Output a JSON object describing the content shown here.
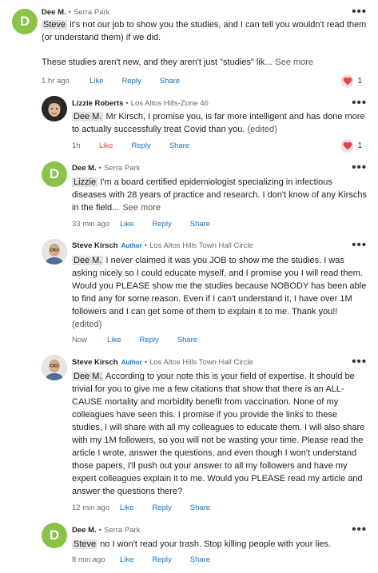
{
  "more_label": "•••",
  "comments": [
    {
      "avatar_letter": "D",
      "name": "Dee M.",
      "location": "Serra Park",
      "mention": "Steve",
      "text": "it's not our job to show you the studies, and I can tell you wouldn't read them (or understand them) if we did.",
      "text2": "These studies aren't new, and they aren't just \"studies\" lik...",
      "see_more": "See more",
      "time": "1 hr ago",
      "like": "Like",
      "reply": "Reply",
      "share": "Share",
      "reaction_count": "1"
    },
    {
      "name": "Lizzie Roberts",
      "location": "Los Altos Hills-Zone 46",
      "mention": "Dee M.",
      "text": "Mr Kirsch, I promise you, is far more intelligent and has done more to actually successfully treat Covid than you.",
      "edited": "(edited)",
      "time": "1h",
      "like": "Like",
      "reply": "Reply",
      "share": "Share",
      "reaction_count": "1"
    },
    {
      "avatar_letter": "D",
      "name": "Dee M.",
      "location": "Serra Park",
      "mention": "Lizzie",
      "text": "I'm a board certified epidemiologist specializing in infectious diseases with 28 years of practice and research. I don't know of any Kirschs in the field...",
      "see_more": "See more",
      "time": "33 min ago",
      "like": "Like",
      "reply": "Reply",
      "share": "Share"
    },
    {
      "name": "Steve Kirsch",
      "badge": "Author",
      "location": "Los Altos Hills Town Hall Circle",
      "mention": "Dee M.",
      "text": "I never claimed it was you JOB to show me the studies. I was asking nicely so I could educate myself, and I promise you I will read them. Would you PLEASE show me the studies because NOBODY has been able to find any for some reason. Even if I can't understand it, I have over 1M followers and I can get some of them to explain it to me. Thank you!!",
      "edited": "(edited)",
      "time": "Now",
      "like": "Like",
      "reply": "Reply",
      "share": "Share"
    },
    {
      "name": "Steve Kirsch",
      "badge": "Author",
      "location": "Los Altos Hills Town Hall Circle",
      "mention": "Dee M.",
      "text": "According to your note this is your field of expertise. It should be trivial for you to give me a few citations that show that there is an ALL-CAUSE mortality and morbidity benefit from vaccination. None of my colleagues have seen this. I promise if you provide the links to these studies, I will share with all my colleagues to educate them. I will also share with my 1M followers, so you will not be wasting your time. Please read the article I wrote, answer the questions, and even though I won't understand those papers, I'll push out your answer to all my followers and have my expert colleagues explain it to me. Would you PLEASE read my article and answer the questions there?",
      "time": "12 min ago",
      "like": "Like",
      "reply": "Reply",
      "share": "Share"
    },
    {
      "avatar_letter": "D",
      "name": "Dee M.",
      "location": "Serra Park",
      "mention": "Steve",
      "text": "no I won't read your trash. Stop killing people with your lies.",
      "time": "8 min ago",
      "like": "Like",
      "reply": "Reply",
      "share": "Share"
    }
  ]
}
